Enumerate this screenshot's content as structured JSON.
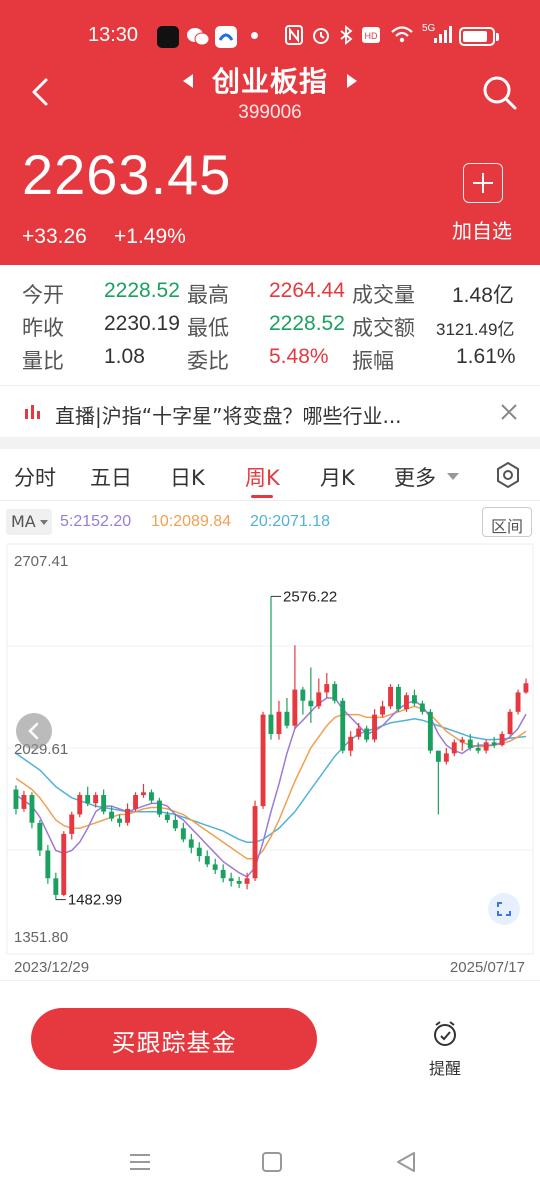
{
  "status_bar": {
    "time": "13:30",
    "network": "5G",
    "battery_level": 0.85,
    "icons": [
      "tiktok-icon",
      "wechat-icon",
      "app-icon",
      "nfc-icon",
      "alarm-icon",
      "bluetooth-icon",
      "hd-icon",
      "wifi-icon",
      "signal-icon",
      "battery-icon"
    ]
  },
  "header": {
    "title": "创业板指",
    "code": "399006",
    "price": "2263.45",
    "change": "+33.26",
    "change_pct": "+1.49%",
    "add_label": "加自选",
    "background": "#e5393f"
  },
  "stats": [
    {
      "label": "今开",
      "value": "2228.52",
      "color": "green"
    },
    {
      "label": "最高",
      "value": "2264.44",
      "color": "red"
    },
    {
      "label": "成交量",
      "value": "1.48亿",
      "color": "dark"
    },
    {
      "label": "昨收",
      "value": "2230.19",
      "color": "dark"
    },
    {
      "label": "最低",
      "value": "2228.52",
      "color": "green"
    },
    {
      "label": "成交额",
      "value": "3121.49亿",
      "color": "dark"
    },
    {
      "label": "量比",
      "value": "1.08",
      "color": "dark"
    },
    {
      "label": "委比",
      "value": "5.48%",
      "color": "red"
    },
    {
      "label": "振幅",
      "value": "1.61%",
      "color": "dark"
    }
  ],
  "news": {
    "text": "直播|沪指“十字星”将变盘？哪些行业..."
  },
  "tabs": [
    {
      "label": "分时",
      "active": false
    },
    {
      "label": "五日",
      "active": false
    },
    {
      "label": "日K",
      "active": false
    },
    {
      "label": "周K",
      "active": true
    },
    {
      "label": "月K",
      "active": false
    },
    {
      "label": "更多",
      "active": false
    }
  ],
  "ma": {
    "select_label": "MA",
    "ma5": "5:2152.20",
    "ma10": "10:2089.84",
    "ma20": "20:2071.18",
    "range_label": "区间",
    "colors": {
      "ma5": "#9b7bd6",
      "ma10": "#f0a050",
      "ma20": "#4fb3d9"
    }
  },
  "chart_data": {
    "type": "candlestick",
    "title": "",
    "y_top_label": "2707.41",
    "y_mid_label": "2029.61",
    "y_bottom_label": "1351.80",
    "ylim": [
      1351.8,
      2707.41
    ],
    "x_start_label": "2023/12/29",
    "x_end_label": "2025/07/17",
    "max_marker": {
      "label": "2576.22",
      "value": 2576.22
    },
    "min_marker": {
      "label": "1482.99",
      "value": 1482.99
    },
    "up_color": "#e5393f",
    "down_color": "#1aa160",
    "candles": [
      {
        "o": 1880,
        "c": 1810,
        "h": 1895,
        "l": 1790
      },
      {
        "o": 1810,
        "c": 1860,
        "h": 1875,
        "l": 1800
      },
      {
        "o": 1860,
        "c": 1760,
        "h": 1870,
        "l": 1740
      },
      {
        "o": 1760,
        "c": 1660,
        "h": 1770,
        "l": 1640
      },
      {
        "o": 1660,
        "c": 1560,
        "h": 1680,
        "l": 1540
      },
      {
        "o": 1560,
        "c": 1500,
        "h": 1580,
        "l": 1483
      },
      {
        "o": 1500,
        "c": 1720,
        "h": 1730,
        "l": 1495
      },
      {
        "o": 1720,
        "c": 1790,
        "h": 1800,
        "l": 1700
      },
      {
        "o": 1790,
        "c": 1860,
        "h": 1870,
        "l": 1780
      },
      {
        "o": 1860,
        "c": 1830,
        "h": 1890,
        "l": 1820
      },
      {
        "o": 1830,
        "c": 1860,
        "h": 1870,
        "l": 1815
      },
      {
        "o": 1860,
        "c": 1800,
        "h": 1880,
        "l": 1790
      },
      {
        "o": 1800,
        "c": 1775,
        "h": 1820,
        "l": 1765
      },
      {
        "o": 1775,
        "c": 1760,
        "h": 1790,
        "l": 1745
      },
      {
        "o": 1760,
        "c": 1810,
        "h": 1830,
        "l": 1750
      },
      {
        "o": 1810,
        "c": 1860,
        "h": 1870,
        "l": 1800
      },
      {
        "o": 1860,
        "c": 1870,
        "h": 1900,
        "l": 1850
      },
      {
        "o": 1870,
        "c": 1840,
        "h": 1880,
        "l": 1830
      },
      {
        "o": 1840,
        "c": 1790,
        "h": 1850,
        "l": 1780
      },
      {
        "o": 1790,
        "c": 1770,
        "h": 1800,
        "l": 1760
      },
      {
        "o": 1770,
        "c": 1740,
        "h": 1790,
        "l": 1730
      },
      {
        "o": 1740,
        "c": 1700,
        "h": 1760,
        "l": 1690
      },
      {
        "o": 1700,
        "c": 1670,
        "h": 1720,
        "l": 1650
      },
      {
        "o": 1670,
        "c": 1640,
        "h": 1690,
        "l": 1620
      },
      {
        "o": 1640,
        "c": 1610,
        "h": 1660,
        "l": 1600
      },
      {
        "o": 1610,
        "c": 1590,
        "h": 1630,
        "l": 1575
      },
      {
        "o": 1590,
        "c": 1560,
        "h": 1610,
        "l": 1545
      },
      {
        "o": 1560,
        "c": 1550,
        "h": 1580,
        "l": 1530
      },
      {
        "o": 1550,
        "c": 1540,
        "h": 1565,
        "l": 1525
      },
      {
        "o": 1540,
        "c": 1560,
        "h": 1580,
        "l": 1520
      },
      {
        "o": 1560,
        "c": 1820,
        "h": 1840,
        "l": 1550
      },
      {
        "o": 1820,
        "c": 2150,
        "h": 2160,
        "l": 1810
      },
      {
        "o": 2150,
        "c": 2080,
        "h": 2576,
        "l": 2060
      },
      {
        "o": 2080,
        "c": 2160,
        "h": 2200,
        "l": 2060
      },
      {
        "o": 2160,
        "c": 2110,
        "h": 2210,
        "l": 2100
      },
      {
        "o": 2110,
        "c": 2240,
        "h": 2400,
        "l": 2100
      },
      {
        "o": 2240,
        "c": 2200,
        "h": 2250,
        "l": 2150
      },
      {
        "o": 2200,
        "c": 2180,
        "h": 2320,
        "l": 2120
      },
      {
        "o": 2180,
        "c": 2230,
        "h": 2280,
        "l": 2170
      },
      {
        "o": 2230,
        "c": 2260,
        "h": 2300,
        "l": 2210
      },
      {
        "o": 2260,
        "c": 2200,
        "h": 2270,
        "l": 2190
      },
      {
        "o": 2200,
        "c": 2020,
        "h": 2210,
        "l": 2010
      },
      {
        "o": 2020,
        "c": 2070,
        "h": 2090,
        "l": 2000
      },
      {
        "o": 2070,
        "c": 2100,
        "h": 2120,
        "l": 2060
      },
      {
        "o": 2100,
        "c": 2060,
        "h": 2110,
        "l": 2050
      },
      {
        "o": 2060,
        "c": 2150,
        "h": 2170,
        "l": 2050
      },
      {
        "o": 2150,
        "c": 2180,
        "h": 2200,
        "l": 2140
      },
      {
        "o": 2180,
        "c": 2250,
        "h": 2260,
        "l": 2170
      },
      {
        "o": 2250,
        "c": 2170,
        "h": 2260,
        "l": 2160
      },
      {
        "o": 2170,
        "c": 2220,
        "h": 2230,
        "l": 2160
      },
      {
        "o": 2220,
        "c": 2190,
        "h": 2240,
        "l": 2180
      },
      {
        "o": 2190,
        "c": 2160,
        "h": 2200,
        "l": 2150
      },
      {
        "o": 2160,
        "c": 2020,
        "h": 2170,
        "l": 2010
      },
      {
        "o": 2020,
        "c": 1980,
        "h": 2020,
        "l": 1790
      },
      {
        "o": 1980,
        "c": 2010,
        "h": 2030,
        "l": 1970
      },
      {
        "o": 2010,
        "c": 2050,
        "h": 2060,
        "l": 2000
      },
      {
        "o": 2050,
        "c": 2060,
        "h": 2070,
        "l": 2020
      },
      {
        "o": 2060,
        "c": 2030,
        "h": 2080,
        "l": 2020
      },
      {
        "o": 2030,
        "c": 2020,
        "h": 2050,
        "l": 2010
      },
      {
        "o": 2020,
        "c": 2050,
        "h": 2060,
        "l": 2010
      },
      {
        "o": 2050,
        "c": 2040,
        "h": 2070,
        "l": 2030
      },
      {
        "o": 2040,
        "c": 2080,
        "h": 2090,
        "l": 2035
      },
      {
        "o": 2080,
        "c": 2160,
        "h": 2170,
        "l": 2075
      },
      {
        "o": 2160,
        "c": 2230,
        "h": 2240,
        "l": 2150
      },
      {
        "o": 2230,
        "c": 2263,
        "h": 2280,
        "l": 2225
      }
    ],
    "ma5": [
      1860,
      1840,
      1820,
      1780,
      1720,
      1660,
      1650,
      1660,
      1690,
      1740,
      1800,
      1820,
      1820,
      1810,
      1800,
      1810,
      1820,
      1830,
      1830,
      1820,
      1790,
      1770,
      1740,
      1710,
      1680,
      1650,
      1620,
      1600,
      1580,
      1565,
      1600,
      1690,
      1800,
      1900,
      2010,
      2100,
      2130,
      2160,
      2190,
      2210,
      2210,
      2170,
      2140,
      2110,
      2080,
      2090,
      2110,
      2140,
      2170,
      2190,
      2200,
      2180,
      2140,
      2080,
      2040,
      2020,
      2010,
      2030,
      2040,
      2040,
      2040,
      2050,
      2070,
      2100,
      2152
    ],
    "ma10": [
      1920,
      1900,
      1880,
      1850,
      1810,
      1770,
      1750,
      1740,
      1740,
      1750,
      1760,
      1770,
      1780,
      1790,
      1790,
      1800,
      1810,
      1815,
      1815,
      1810,
      1800,
      1790,
      1770,
      1750,
      1730,
      1710,
      1690,
      1670,
      1650,
      1630,
      1630,
      1660,
      1710,
      1770,
      1840,
      1910,
      1970,
      2030,
      2070,
      2110,
      2140,
      2150,
      2150,
      2150,
      2140,
      2140,
      2140,
      2150,
      2160,
      2170,
      2180,
      2170,
      2150,
      2120,
      2090,
      2070,
      2050,
      2040,
      2035,
      2035,
      2040,
      2045,
      2055,
      2070,
      2090
    ],
    "ma20": [
      2010,
      1990,
      1970,
      1950,
      1920,
      1890,
      1870,
      1850,
      1840,
      1830,
      1820,
      1815,
      1810,
      1805,
      1800,
      1800,
      1800,
      1800,
      1800,
      1795,
      1790,
      1780,
      1770,
      1760,
      1750,
      1740,
      1730,
      1715,
      1700,
      1690,
      1690,
      1700,
      1720,
      1740,
      1770,
      1800,
      1840,
      1880,
      1920,
      1960,
      2000,
      2030,
      2060,
      2080,
      2090,
      2100,
      2110,
      2120,
      2125,
      2130,
      2135,
      2130,
      2120,
      2110,
      2100,
      2090,
      2080,
      2070,
      2065,
      2060,
      2060,
      2062,
      2065,
      2068,
      2071
    ]
  },
  "bottom": {
    "buy_label": "买跟踪基金",
    "remind_label": "提醒"
  }
}
